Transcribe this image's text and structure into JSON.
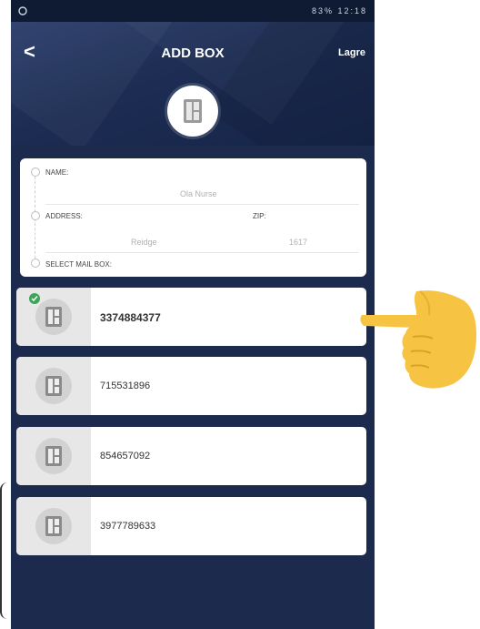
{
  "status_bar": {
    "time": "12:18",
    "battery": "83%"
  },
  "header": {
    "back": "<",
    "title": "ADD BOX",
    "save": "Lagre"
  },
  "form": {
    "name_label": "NAME:",
    "name_value": "Ola Nurse",
    "address_label": "ADDRESS:",
    "address_value": "Reidge",
    "zip_label": "ZIP:",
    "zip_value": "1617",
    "select_label": "SELECT MAIL BOX:"
  },
  "boxes": [
    {
      "number": "3374884377",
      "selected": true
    },
    {
      "number": "715531896",
      "selected": false
    },
    {
      "number": "854657092",
      "selected": false
    },
    {
      "number": "3977789633",
      "selected": false
    }
  ],
  "colors": {
    "background": "#1b2a4d",
    "selected_check": "#3aa657",
    "hand": "#f6c342"
  }
}
